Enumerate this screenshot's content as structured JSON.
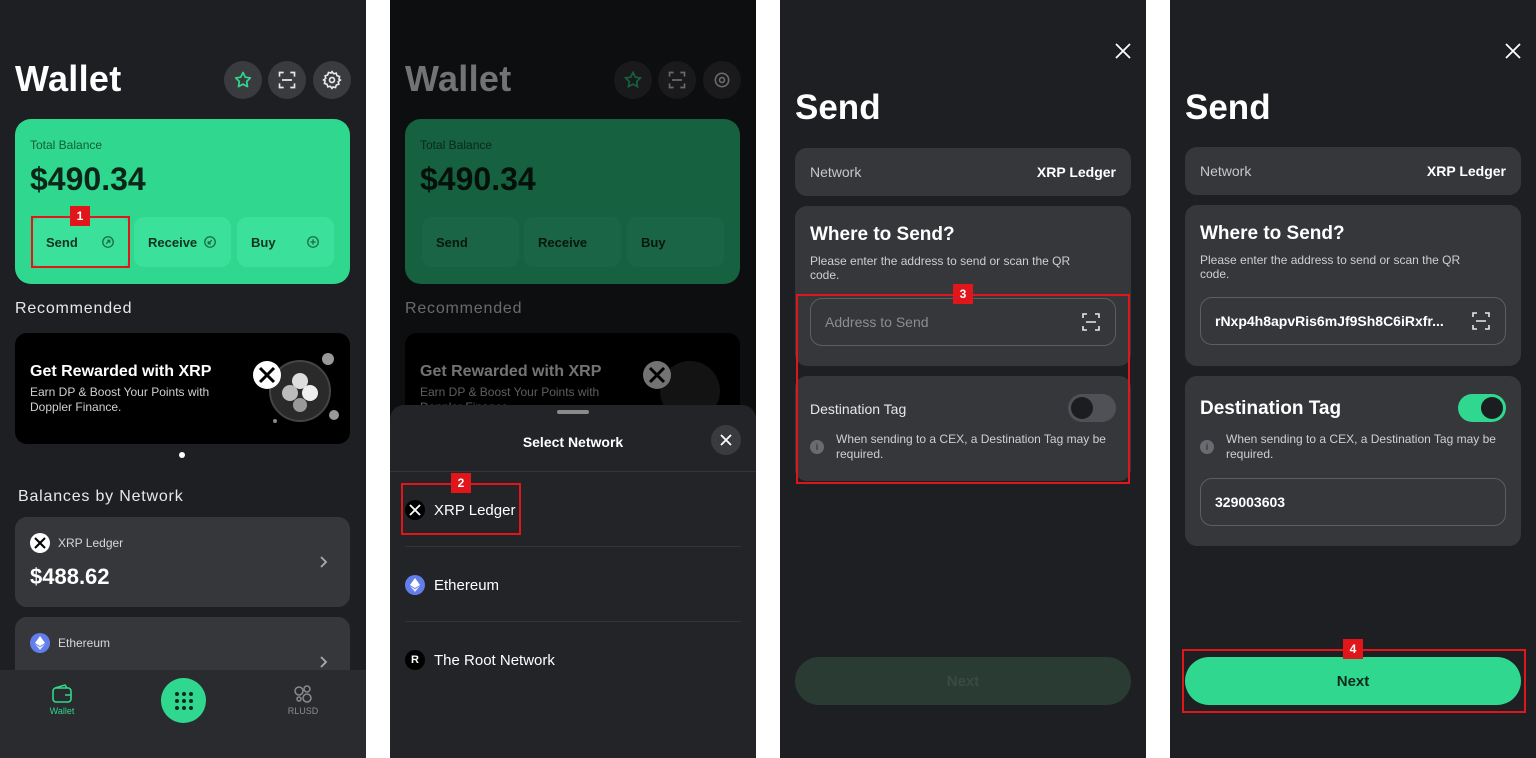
{
  "colors": {
    "accent": "#2fd88e",
    "bg": "#1e1f22",
    "card": "#36373b",
    "annotation": "#e0161b"
  },
  "wallet": {
    "title": "Wallet",
    "header_icons": [
      "star-icon",
      "scan-icon",
      "gear-icon"
    ],
    "balance_label": "Total Balance",
    "balance_value": "$490.34",
    "actions": {
      "send": "Send",
      "receive": "Receive",
      "buy": "Buy"
    },
    "recommended_title": "Recommended",
    "promo": {
      "title": "Get Rewarded with XRP",
      "subtitle": "Earn DP & Boost Your Points with Doppler Finance."
    },
    "balances_title": "Balances by Network",
    "networks": [
      {
        "name": "XRP Ledger",
        "value": "$488.62"
      },
      {
        "name": "Ethereum",
        "value": ""
      }
    ],
    "nav": {
      "wallet": "Wallet",
      "rlusd": "RLUSD"
    }
  },
  "select_network": {
    "title": "Select Network",
    "options": [
      "XRP Ledger",
      "Ethereum",
      "The Root Network"
    ]
  },
  "send_empty": {
    "title": "Send",
    "network_label": "Network",
    "network_value": "XRP Ledger",
    "where_title": "Where to Send?",
    "where_sub": "Please enter the address to send or scan the QR code.",
    "address_placeholder": "Address to Send",
    "dest_tag_label": "Destination Tag",
    "dest_tag_info": "When sending to a CEX, a Destination Tag may be required.",
    "next": "Next"
  },
  "send_filled": {
    "title": "Send",
    "network_label": "Network",
    "network_value": "XRP Ledger",
    "where_title": "Where to Send?",
    "where_sub": "Please enter the address to send or scan the QR code.",
    "address_value": "rNxp4h8apvRis6mJf9Sh8C6iRxfr...",
    "dest_tag_label": "Destination Tag",
    "dest_tag_info": "When sending to a CEX, a Destination Tag may be required.",
    "dest_tag_value": "329003603",
    "next": "Next"
  },
  "annotations": [
    "1",
    "2",
    "3",
    "4"
  ]
}
